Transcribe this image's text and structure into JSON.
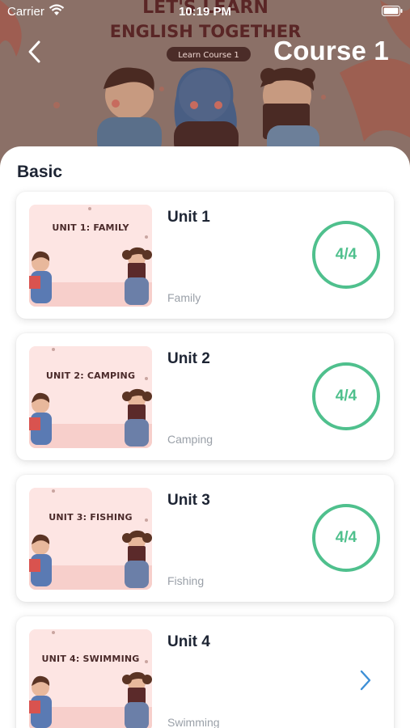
{
  "status_bar": {
    "carrier": "Carrier",
    "time": "10:19 PM"
  },
  "header": {
    "title": "Course 1"
  },
  "banner": {
    "line1": "LET'S LEARN",
    "line2": "ENGLISH TOGETHER",
    "tag": "Learn Course 1"
  },
  "section": {
    "title": "Basic"
  },
  "units": [
    {
      "title": "Unit 1",
      "subtitle": "Family",
      "thumb_label": "UNIT 1: FAMILY",
      "progress": "4/4"
    },
    {
      "title": "Unit 2",
      "subtitle": "Camping",
      "thumb_label": "UNIT 2: CAMPING",
      "progress": "4/4"
    },
    {
      "title": "Unit 3",
      "subtitle": "Fishing",
      "thumb_label": "UNIT 3: FISHING",
      "progress": "4/4"
    },
    {
      "title": "Unit 4",
      "subtitle": "Swimming",
      "thumb_label": "UNIT 4: SWIMMING"
    }
  ],
  "colors": {
    "accent_green": "#4fc08d",
    "chevron_blue": "#3d8fd6",
    "title_dark": "#1d2433",
    "subtitle_grey": "#9aa0a8",
    "thumb_pink": "#fde5e3"
  },
  "icons": {
    "back": "chevron-left-icon",
    "open": "chevron-right-icon",
    "wifi": "wifi-icon",
    "battery": "battery-icon"
  }
}
